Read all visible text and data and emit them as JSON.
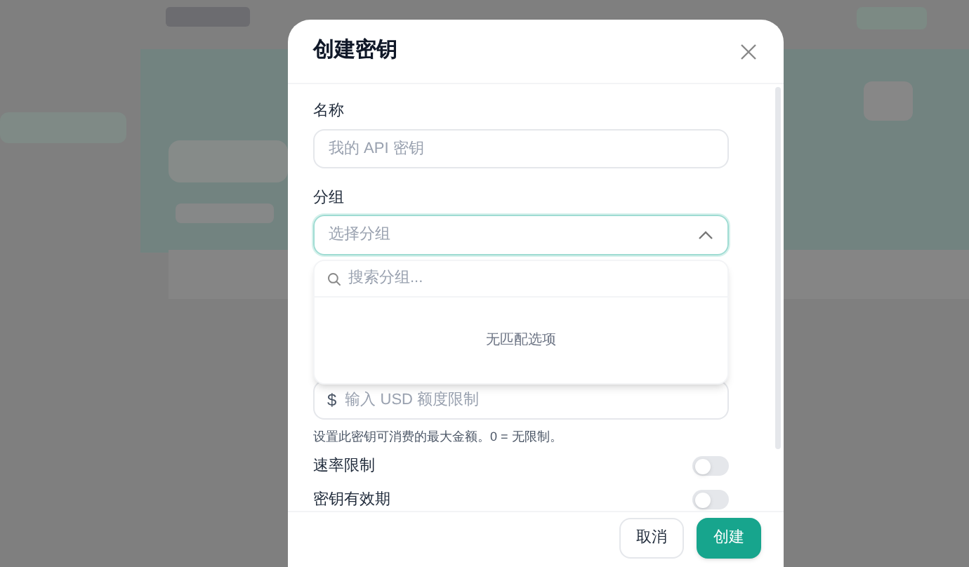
{
  "dialog": {
    "title": "创建密钥",
    "name_field": {
      "label": "名称",
      "placeholder": "我的 API 密钥"
    },
    "group_field": {
      "label": "分组",
      "placeholder": "选择分组",
      "expanded": true
    },
    "group_dropdown": {
      "search_placeholder": "搜索分组...",
      "empty_text": "无匹配选项"
    },
    "limit_field": {
      "prefix": "$",
      "placeholder": "输入 USD 额度限制",
      "hint": "设置此密钥可消费的最大金额。0 = 无限制。"
    },
    "toggles": [
      {
        "label": "速率限制",
        "on": false
      },
      {
        "label": "密钥有效期",
        "on": false
      }
    ],
    "buttons": [
      {
        "label": "取消",
        "kind": "secondary"
      },
      {
        "label": "创建",
        "kind": "primary"
      }
    ]
  }
}
